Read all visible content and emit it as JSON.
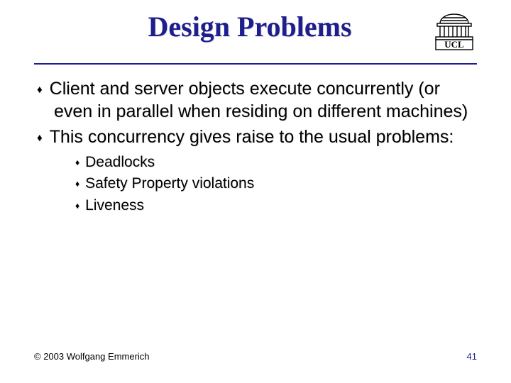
{
  "title": "Design Problems",
  "logo": {
    "label": "UCL"
  },
  "bullets": [
    {
      "text": "Client and server objects execute concurrently (or even in parallel when residing on different machines)"
    },
    {
      "text": "This concurrency gives raise to the usual problems:"
    }
  ],
  "sub_bullets": [
    {
      "text": "Deadlocks"
    },
    {
      "text": "Safety Property violations"
    },
    {
      "text": "Liveness"
    }
  ],
  "footer": {
    "copyright": "© 2003 Wolfgang Emmerich",
    "page": "41"
  }
}
